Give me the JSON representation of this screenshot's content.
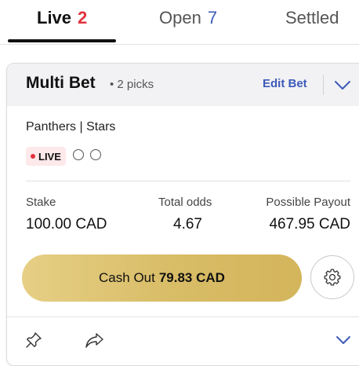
{
  "tabs": [
    {
      "label": "Live",
      "count": "2"
    },
    {
      "label": "Open",
      "count": "7"
    },
    {
      "label": "Settled"
    }
  ],
  "bet": {
    "title": "Multi Bet",
    "picks": "• 2 picks",
    "edit_label": "Edit Bet",
    "teams": "Panthers | Stars",
    "live_label": "LIVE",
    "stake_label": "Stake",
    "stake_value": "100.00 CAD",
    "odds_label": "Total odds",
    "odds_value": "4.67",
    "payout_label": "Possible Payout",
    "payout_value": "467.95 CAD",
    "cashout_label": "Cash Out",
    "cashout_amount": "79.83 CAD"
  },
  "colors": {
    "live_count": "#e2323d",
    "open_count": "#3d5ab8",
    "accent_blue": "#3d5ab8",
    "cashout_gold": "#d8bc66",
    "live_badge_bg": "#fde8ea"
  },
  "icons": [
    "chevron-down-icon",
    "gear-icon",
    "pin-icon",
    "share-icon"
  ]
}
